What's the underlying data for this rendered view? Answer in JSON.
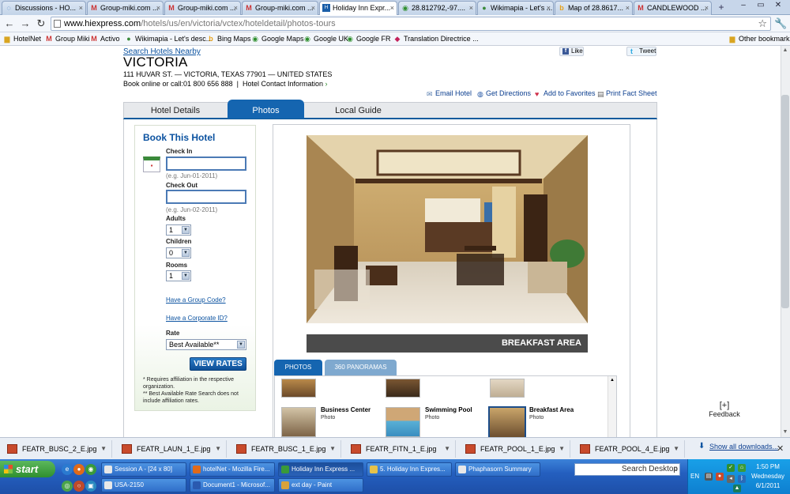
{
  "browser": {
    "tabs": [
      {
        "label": "Discussions - HO...",
        "icon": "chat-icon",
        "active": false
      },
      {
        "label": "Group-miki.com ...",
        "icon": "gmail-icon",
        "active": false
      },
      {
        "label": "Group-miki.com ...",
        "icon": "gmail-icon",
        "active": false
      },
      {
        "label": "Group-miki.com ...",
        "icon": "gmail-icon",
        "active": false
      },
      {
        "label": "Holiday Inn Expr...",
        "icon": "hiexpress-icon",
        "active": true
      },
      {
        "label": "28.812792,-97....",
        "icon": "google-maps-icon",
        "active": false
      },
      {
        "label": "Wikimapia - Let's ...",
        "icon": "globe-icon",
        "active": false
      },
      {
        "label": "Map of 28.8617...",
        "icon": "bing-icon",
        "active": false
      },
      {
        "label": "CANDLEWOOD ...",
        "icon": "gmail-icon",
        "active": false
      }
    ],
    "url_domain": "www.hiexpress.com",
    "url_path": "/hotels/us/en/victoria/vctex/hoteldetail/photos-tours",
    "bookmarks": [
      {
        "label": "HotelNet",
        "icon": "folder-icon"
      },
      {
        "label": "Group Miki",
        "icon": "gmail-icon"
      },
      {
        "label": "Activo",
        "icon": "gmail-icon"
      },
      {
        "label": "Wikimapia - Let's desc...",
        "icon": "globe-icon"
      },
      {
        "label": "Bing Maps",
        "icon": "bing-icon"
      },
      {
        "label": "Google Maps",
        "icon": "google-maps-icon"
      },
      {
        "label": "Google UK",
        "icon": "google-maps-icon"
      },
      {
        "label": "Google FR",
        "icon": "google-maps-icon"
      },
      {
        "label": "Translation Directrice ...",
        "icon": "translate-icon"
      }
    ],
    "other_bookmarks": "Other bookmarks"
  },
  "hotel": {
    "search_nearby": "Search Hotels Nearby",
    "name": "VICTORIA",
    "address": "111 HUVAR ST. — VICTORIA, TEXAS 77901 — UNITED STATES",
    "book_line": "Book online or call:01 800 656 888",
    "contact_link": "Hotel Contact Information",
    "like": "Like",
    "tweet": "Tweet",
    "actions": {
      "email": "Email Hotel",
      "directions": "Get Directions",
      "favorites": "Add to Favorites",
      "print": "Print Fact Sheet"
    },
    "tabs": [
      "Hotel Details",
      "Photos",
      "Local Guide"
    ]
  },
  "booking": {
    "title": "Book This Hotel",
    "check_in_label": "Check In",
    "check_in_hint": "(e.g. Jun-01-2011)",
    "check_out_label": "Check Out",
    "check_out_hint": "(e.g. Jun-02-2011)",
    "adults_label": "Adults",
    "adults_value": "1",
    "children_label": "Children",
    "children_value": "0",
    "rooms_label": "Rooms",
    "rooms_value": "1",
    "group_code": "Have a Group Code?",
    "corporate_id": "Have a Corporate ID?",
    "rate_label": "Rate",
    "rate_value": "Best Available**",
    "view_rates": "VIEW RATES",
    "note1": "* Requires affiliation in the respective organization.",
    "note2": "** Best Available Rate Search does not include affiliation rates."
  },
  "gallery": {
    "caption": "BREAKFAST AREA",
    "tabs": [
      "PHOTOS",
      "360 PANORAMAS"
    ],
    "items": [
      {
        "name": "Business Center",
        "type": "Photo"
      },
      {
        "name": "Swimming Pool",
        "type": "Photo"
      },
      {
        "name": "Breakfast Area",
        "type": "Photo"
      }
    ],
    "feedback_icon": "[+]",
    "feedback": "Feedback"
  },
  "downloads": {
    "files": [
      "FEATR_BUSC_2_E.jpg",
      "FEATR_LAUN_1_E.jpg",
      "FEATR_BUSC_1_E.jpg",
      "FEATR_FITN_1_E.jpg",
      "FEATR_POOL_1_E.jpg",
      "FEATR_POOL_4_E.jpg"
    ],
    "show_all": "Show all downloads..."
  },
  "taskbar": {
    "start": "start",
    "row1": [
      "Session A - [24 x 80]",
      "hotelNet - Mozilla Fire...",
      "Holiday Inn Express ...",
      "5. Holiday Inn Expres...",
      "Phaphasorn Summary"
    ],
    "row2": [
      "USA-2150",
      "Document1 - Microsof...",
      "ext day - Paint"
    ],
    "search_placeholder": "Search Desktop",
    "lang": "EN",
    "time": "1:50 PM",
    "day": "Wednesday",
    "date": "6/1/2011"
  }
}
